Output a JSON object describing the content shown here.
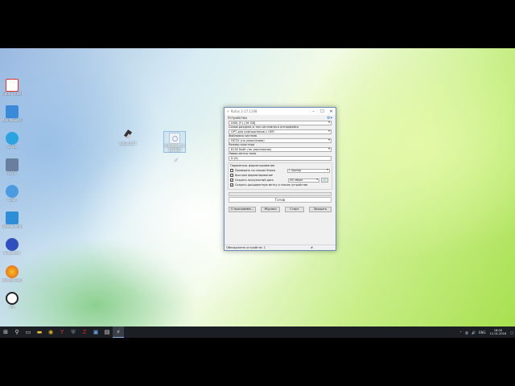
{
  "desktop": {
    "icons": [
      {
        "label": "iSpring Free Cam 8",
        "color": "#e03030"
      },
      {
        "label": "Max Mount Lite",
        "color": "#3b8ad9"
      },
      {
        "label": "Skype",
        "color": "#2aa3e0"
      },
      {
        "label": "Gi Ex",
        "color": "#6a7fa0"
      },
      {
        "label": "Chat",
        "color": "#4a9be0"
      },
      {
        "label": "Панель управления",
        "color": "#2e8fd8"
      },
      {
        "label": "Speedtest",
        "color": "#3050c0"
      },
      {
        "label": "Mozilla Firefox",
        "color": "#e05a1a"
      },
      {
        "label": "Fly",
        "color": "#222222"
      }
    ],
    "files": [
      {
        "label": "rufus-2.17"
      },
      {
        "label": "Windows 10 x64 ISO"
      }
    ]
  },
  "rufus": {
    "title": "Rufus 2.17.1198",
    "header": "Устройство",
    "device": "DISK (F:) [16 GB]",
    "partition_label": "Схема раздела и тип системного интерфейса",
    "partition_value": "GPT для компьютеров с UEFI",
    "fs_label": "Файловая система",
    "fs_value": "FAT32 (по умолчанию)",
    "cluster_label": "Размер кластера",
    "cluster_value": "8192 байт (по умолчанию)",
    "volume_label": "Новая метка тома",
    "volume_value": "D (4)",
    "format_group": "Параметры форматирования",
    "opt_check_bad": "Проверить на плохие блоки",
    "opt_passes": "1 проход",
    "opt_quick": "Быстрое форматирование",
    "opt_bootable": "Создать загрузочный диск",
    "opt_iso": "ISO-образ",
    "opt_extended": "Создать расширенную метку и значок устройства",
    "status": "Готов",
    "btn_about": "О программе...",
    "btn_log": "Журнал",
    "btn_start": "Старт",
    "btn_close": "Закрыть",
    "statusbar": "Обнаружено устройств: 1",
    "statusbar_x": "#"
  },
  "taskbar": {
    "lang": "ENG",
    "time": "18:00",
    "date": "12.01.2018"
  }
}
